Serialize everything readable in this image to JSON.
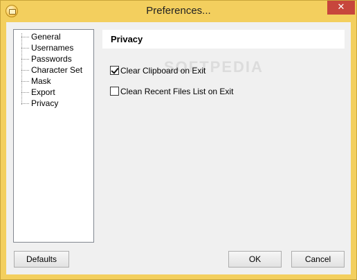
{
  "window": {
    "title": "Preferences...",
    "close_glyph": "✕"
  },
  "sidebar": {
    "items": [
      {
        "label": "General"
      },
      {
        "label": "Usernames"
      },
      {
        "label": "Passwords"
      },
      {
        "label": "Character Set"
      },
      {
        "label": "Mask"
      },
      {
        "label": "Export"
      },
      {
        "label": "Privacy",
        "selected": true
      }
    ]
  },
  "panel": {
    "title": "Privacy",
    "options": [
      {
        "label": "Clear Clipboard on Exit",
        "checked": true
      },
      {
        "label": "Clean Recent Files List on Exit",
        "checked": false
      }
    ],
    "watermark": "SOFTPEDIA"
  },
  "buttons": {
    "defaults": "Defaults",
    "ok": "OK",
    "cancel": "Cancel"
  },
  "colors": {
    "frame": "#f3cf5e",
    "close": "#c7463c",
    "client": "#f0f0f0"
  }
}
